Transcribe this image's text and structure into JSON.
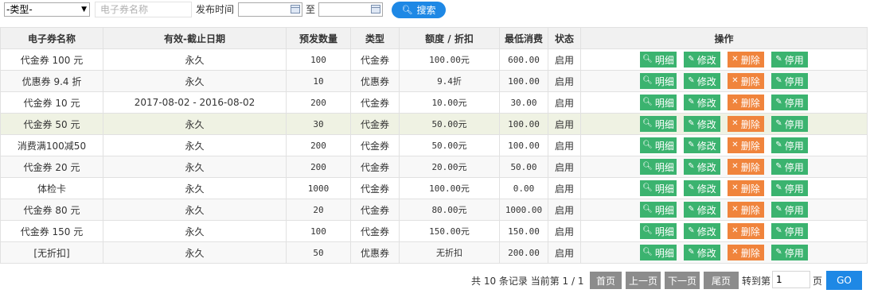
{
  "filters": {
    "type_select": "-类型-",
    "name_placeholder": "电子券名称",
    "publish_time_label": "发布时间",
    "to_label": "至",
    "search_label": "搜索"
  },
  "table": {
    "headers": [
      "电子券名称",
      "有效-截止日期",
      "预发数量",
      "类型",
      "额度 / 折扣",
      "最低消费",
      "状态",
      "操作"
    ],
    "rows": [
      [
        "代金券 100 元",
        "永久",
        "100",
        "代金券",
        "100.00元",
        "600.00",
        "启用"
      ],
      [
        "优惠券 9.4 折",
        "永久",
        "10",
        "优惠券",
        "9.4折",
        "100.00",
        "启用"
      ],
      [
        "代金券 10 元",
        "2017-08-02 - 2016-08-02",
        "200",
        "代金券",
        "10.00元",
        "30.00",
        "启用"
      ],
      [
        "代金券 50 元",
        "永久",
        "30",
        "代金券",
        "50.00元",
        "100.00",
        "启用"
      ],
      [
        "消费满100减50",
        "永久",
        "200",
        "代金券",
        "50.00元",
        "100.00",
        "启用"
      ],
      [
        "代金券 20 元",
        "永久",
        "200",
        "代金券",
        "20.00元",
        "50.00",
        "启用"
      ],
      [
        "体检卡",
        "永久",
        "1000",
        "代金券",
        "100.00元",
        "0.00",
        "启用"
      ],
      [
        "代金券 80 元",
        "永久",
        "20",
        "代金券",
        "80.00元",
        "1000.00",
        "启用"
      ],
      [
        "代金券 150 元",
        "永久",
        "100",
        "代金券",
        "150.00元",
        "150.00",
        "启用"
      ],
      [
        "[无折扣]",
        "永久",
        "50",
        "优惠券",
        "无折扣",
        "200.00",
        "启用"
      ]
    ],
    "actions": {
      "detail": "明细",
      "edit": "修改",
      "delete": "删除",
      "disable": "停用"
    }
  },
  "pagination": {
    "summary": "共 10 条记录 当前第 1 / 1",
    "first": "首页",
    "prev": "上一页",
    "next": "下一页",
    "last": "尾页",
    "goto_label": "转到第",
    "page_value": "1",
    "page_unit": "页",
    "go": "GO"
  },
  "colors": {
    "primary_blue": "#1e88e5",
    "action_green": "#3bb36f",
    "delete_orange": "#f0843c",
    "pager_gray": "#8c8c8c",
    "highlight_row": "#eff2e3"
  }
}
